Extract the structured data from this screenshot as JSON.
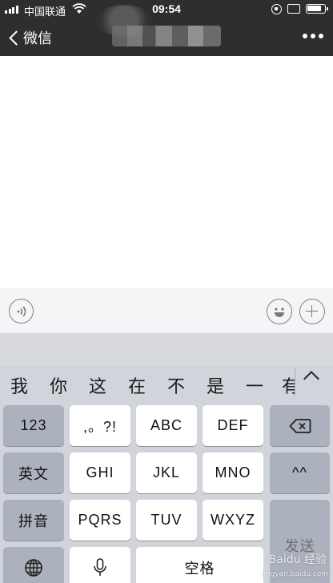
{
  "status_bar": {
    "carrier": "中国联通",
    "time": "09:54"
  },
  "nav": {
    "back_label": "微信",
    "more_icon": "ellipsis-icon"
  },
  "input_bar": {
    "voice_icon": "voice-input-icon",
    "emoji_icon": "emoji-icon",
    "plus_icon": "plus-icon"
  },
  "keyboard": {
    "candidates": [
      "我",
      "你",
      "这",
      "在",
      "不",
      "是",
      "一",
      "有"
    ],
    "keys": {
      "num": "123",
      "punct": ",。?!",
      "abc": "ABC",
      "def": "DEF",
      "delete_icon": "backspace-icon",
      "english": "英文",
      "ghi": "GHI",
      "jkl": "JKL",
      "mno": "MNO",
      "emoticon": "^^",
      "pinyin": "拼音",
      "pqrs": "PQRS",
      "tuv": "TUV",
      "wxyz": "WXYZ",
      "send": "发送",
      "globe_icon": "globe-icon",
      "mic_icon": "microphone-icon",
      "space": "空格"
    }
  },
  "watermark": {
    "text": "Baidu 经验",
    "sub": "jingyan.baidu.com"
  }
}
